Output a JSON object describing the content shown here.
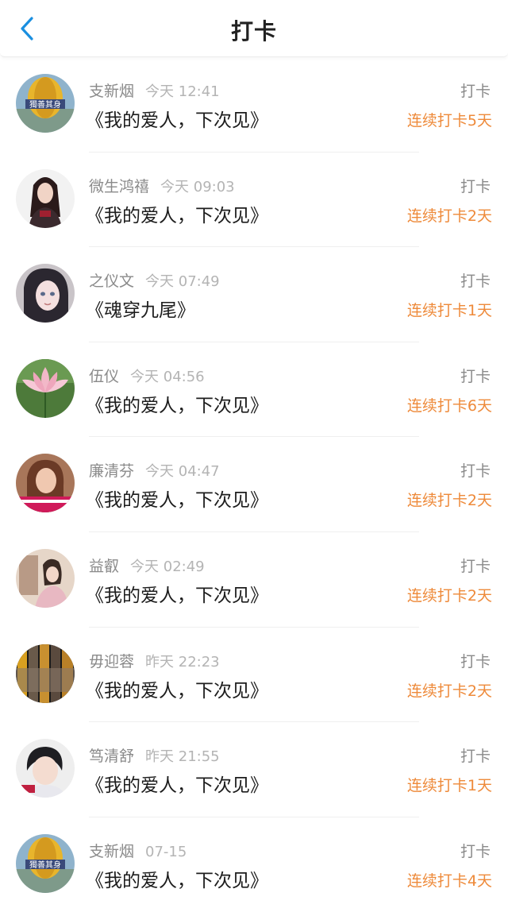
{
  "header": {
    "title": "打卡",
    "back_icon": "chevron-left-icon"
  },
  "colors": {
    "accent": "#1a8fe0",
    "streak": "#ee8a3a",
    "muted": "#8a8a8a"
  },
  "items": [
    {
      "name": "支新烟",
      "time": "今天 12:41",
      "book": "《我的爱人，下次见》",
      "type": "打卡",
      "streak": "连续打卡5天"
    },
    {
      "name": "微生鸿禧",
      "time": "今天 09:03",
      "book": "《我的爱人，下次见》",
      "type": "打卡",
      "streak": "连续打卡2天"
    },
    {
      "name": "之仪文",
      "time": "今天 07:49",
      "book": "《魂穿九尾》",
      "type": "打卡",
      "streak": "连续打卡1天"
    },
    {
      "name": "伍仪",
      "time": "今天 04:56",
      "book": "《我的爱人，下次见》",
      "type": "打卡",
      "streak": "连续打卡6天"
    },
    {
      "name": "廉清芬",
      "time": "今天 04:47",
      "book": "《我的爱人，下次见》",
      "type": "打卡",
      "streak": "连续打卡2天"
    },
    {
      "name": "益叡",
      "time": "今天 02:49",
      "book": "《我的爱人，下次见》",
      "type": "打卡",
      "streak": "连续打卡2天"
    },
    {
      "name": "毋迎蓉",
      "time": "昨天 22:23",
      "book": "《我的爱人，下次见》",
      "type": "打卡",
      "streak": "连续打卡2天"
    },
    {
      "name": "笃清舒",
      "time": "昨天 21:55",
      "book": "《我的爱人，下次见》",
      "type": "打卡",
      "streak": "连续打卡1天"
    },
    {
      "name": "支新烟",
      "time": "07-15",
      "book": "《我的爱人，下次见》",
      "type": "打卡",
      "streak": "连续打卡4天"
    }
  ]
}
